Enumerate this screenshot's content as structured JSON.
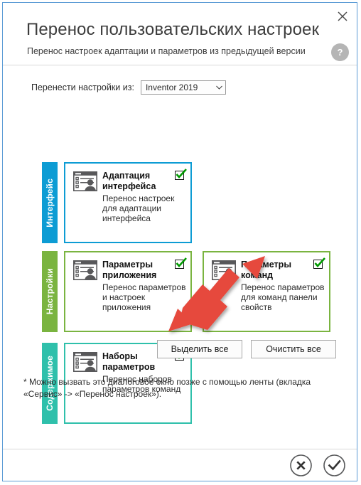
{
  "window": {
    "title": "Перенос пользовательских настроек",
    "subtitle": "Перенос настроек адаптации и параметров из предыдущей версии",
    "close_icon": "close-icon",
    "help_label": "?"
  },
  "source": {
    "label": "Перенести настройки из:",
    "value": "Inventor 2019",
    "caret": "⌄"
  },
  "categories": [
    {
      "name": "interface",
      "tab_label": "Интерфейс",
      "color": "#0d9cd4",
      "cards": [
        {
          "title": "Адаптация интерфейса",
          "desc": "Перенос настроек для адаптации интерфейса",
          "checked": true
        }
      ]
    },
    {
      "name": "settings",
      "tab_label": "Настройки",
      "color": "#7ab440",
      "cards": [
        {
          "title": "Параметры приложения",
          "desc": "Перенос параметров и настроек приложения",
          "checked": true
        },
        {
          "title": "Параметры команд",
          "desc": "Перенос параметров для команд панели свойств",
          "checked": true
        }
      ]
    },
    {
      "name": "content",
      "tab_label": "Содержимое",
      "color": "#2fc0ab",
      "cards": [
        {
          "title": "Наборы параметров",
          "desc": "Перенос наборов параметров команд",
          "checked": true
        }
      ]
    }
  ],
  "actions": {
    "select_all": "Выделить все",
    "clear_all": "Очистить все"
  },
  "note": "* Можно вызвать это диалоговое окно позже с помощью ленты (вкладка «Сервис» -> «Перенос настроек»).",
  "footer": {
    "cancel_icon": "circle-x-icon",
    "ok_icon": "circle-check-icon"
  },
  "annotation": {
    "color": "#e64a3c",
    "type": "double-headed-arrow"
  }
}
